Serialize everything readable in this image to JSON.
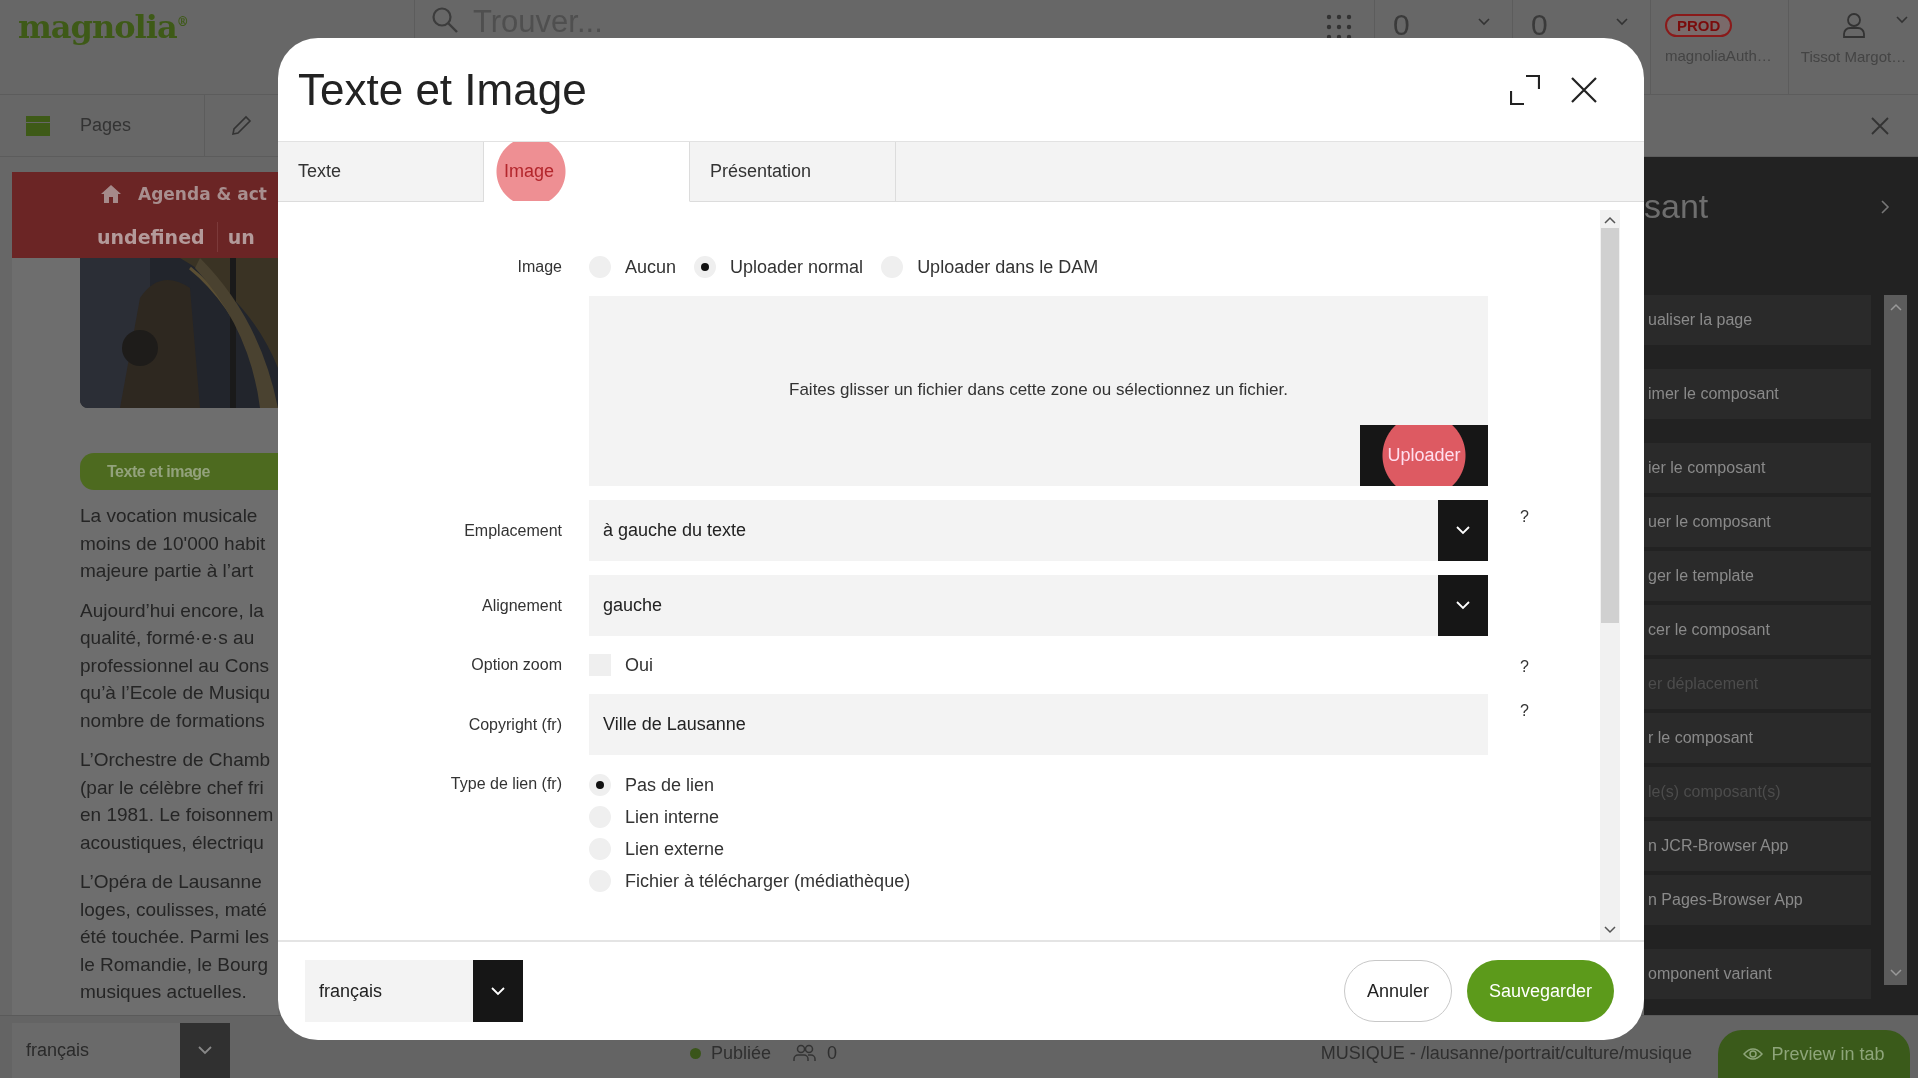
{
  "app_bar": {
    "logo": "magnolia$^{®}$",
    "search": {
      "placeholder": "Trouver..."
    },
    "counters": [
      "0",
      "0"
    ],
    "environment": {
      "badge": "PROD",
      "user": "magnoliaAuth…"
    },
    "account": {
      "name": "Tissot Margot…"
    }
  },
  "toolbar": {
    "pages_tab": "Pages"
  },
  "page": {
    "nav": {
      "main": "Agenda & act",
      "sub": [
        "undefined",
        "un"
      ]
    },
    "component_label": "Texte et image",
    "paragraphs": [
      [
        "La vocation musicale",
        "moins de 10'000 habit",
        "majeure partie à l’art"
      ],
      [
        "Aujourd’hui encore, la",
        "qualité, formé·e·s au",
        "professionnel au Cons",
        "qu’à l’Ecole de Musiqu",
        "nombre de formations"
      ],
      [
        "L’Orchestre de Chamb",
        "(par le célèbre chef fri",
        "en 1981. Le foisonnem",
        "acoustiques, électriqu"
      ],
      [
        "L’Opéra de Lausanne",
        "loges, coulisses, maté",
        "été touchée. Parmi les",
        "le Romandie, le Bourg",
        "musiques actuelles."
      ]
    ]
  },
  "actions_panel": {
    "title": "sant",
    "groups": [
      [
        {
          "label": "ualiser la page",
          "disabled": false
        }
      ],
      [
        {
          "label": "imer le composant",
          "disabled": false
        }
      ],
      [
        {
          "label": "ier le composant",
          "disabled": false
        },
        {
          "label": "uer le composant",
          "disabled": false
        },
        {
          "label": "ger le template",
          "disabled": false
        },
        {
          "label": "cer le composant",
          "disabled": false
        },
        {
          "label": "er déplacement",
          "disabled": true
        },
        {
          "label": "r le composant",
          "disabled": false
        },
        {
          "label": "le(s) composant(s)",
          "disabled": true
        },
        {
          "label": "n JCR-Browser App",
          "disabled": false
        },
        {
          "label": "n Pages-Browser App",
          "disabled": false
        }
      ],
      [
        {
          "label": "omponent variant",
          "disabled": false
        }
      ]
    ]
  },
  "status_bar": {
    "language": "français",
    "status": "Publiée",
    "users": "0",
    "path": "MUSIQUE - /lausanne/portrait/culture/musique",
    "preview_button": "Preview in tab"
  },
  "dialog": {
    "title": "Texte et Image",
    "tabs": [
      {
        "label": "Texte",
        "selected": false,
        "highlighted": false
      },
      {
        "label": "Image",
        "selected": true,
        "highlighted": true
      },
      {
        "label": "Présentation",
        "selected": false,
        "highlighted": false
      }
    ],
    "fields": [
      {
        "kind": "radio-row",
        "label": "Image",
        "options": [
          {
            "label": "Aucun",
            "selected": false
          },
          {
            "label": "Uploader normal",
            "selected": true
          },
          {
            "label": "Uploader dans le DAM",
            "selected": false
          }
        ]
      },
      {
        "kind": "upload",
        "hint": "Faites glisser un fichier dans cette zone ou sélectionnez un fichier.",
        "button": {
          "label": "Uploader",
          "highlighted": true
        }
      },
      {
        "kind": "select",
        "label": "Emplacement",
        "value": "à gauche du texte",
        "help": "?"
      },
      {
        "kind": "select",
        "label": "Alignement",
        "value": "gauche"
      },
      {
        "kind": "checkbox",
        "label": "Option zoom",
        "option": "Oui",
        "checked": false,
        "help": "?"
      },
      {
        "kind": "text",
        "label": "Copyright (fr)",
        "value": "Ville de Lausanne",
        "help": "?"
      },
      {
        "kind": "radio-list",
        "label": "Type de lien (fr)",
        "options": [
          {
            "label": "Pas de lien",
            "selected": true
          },
          {
            "label": "Lien interne",
            "selected": false
          },
          {
            "label": "Lien externe",
            "selected": false
          },
          {
            "label": "Fichier à télécharger (médiathèque)",
            "selected": false
          }
        ]
      }
    ],
    "footer": {
      "language": "français",
      "buttons": [
        {
          "label": "Annuler",
          "kind": "secondary"
        },
        {
          "label": "Sauvegarder",
          "kind": "primary"
        }
      ]
    }
  }
}
